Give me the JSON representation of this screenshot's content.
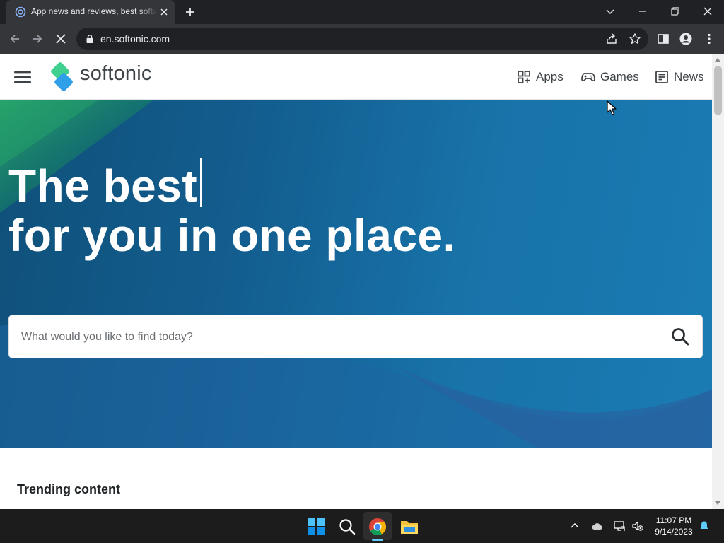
{
  "browser": {
    "tab_title": "App news and reviews, best software",
    "url": "en.softonic.com"
  },
  "site": {
    "logo_text": "softonic",
    "nav": [
      {
        "label": "Apps"
      },
      {
        "label": "Games"
      },
      {
        "label": "News"
      }
    ]
  },
  "hero": {
    "line1": "The best",
    "line2": "for you in one place.",
    "search_placeholder": "What would you like to find today?"
  },
  "trending": {
    "title": "Trending content"
  },
  "taskbar": {
    "time": "11:07 PM",
    "date": "9/14/2023"
  },
  "colors": {
    "brand_green": "#3fcf8e",
    "brand_blue": "#2f9fe8",
    "hero_blue": "#1873a9",
    "chrome_dark": "#202124"
  }
}
